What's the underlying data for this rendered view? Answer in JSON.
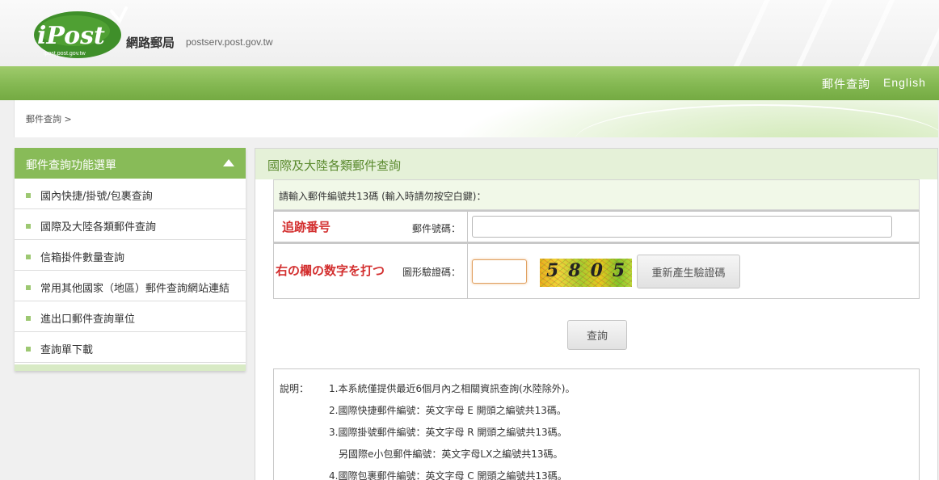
{
  "header": {
    "logo_text": "iPost",
    "logo_sub": "ipost.post.gov.tw",
    "site_name": "網路郵局",
    "site_domain": "postserv.post.gov.tw"
  },
  "nav": {
    "items": [
      {
        "label": "郵件查詢"
      },
      {
        "label": "English"
      }
    ]
  },
  "breadcrumb": "郵件查詢 >",
  "sidebar": {
    "title": "郵件查詢功能選單",
    "items": [
      {
        "label": "國內快捷/掛號/包裹查詢"
      },
      {
        "label": "國際及大陸各類郵件查詢"
      },
      {
        "label": "信箱掛件數量查詢"
      },
      {
        "label": "常用其他國家（地區）郵件查詢網站連結"
      },
      {
        "label": "進出口郵件查詢單位"
      },
      {
        "label": "查詢單下載"
      }
    ]
  },
  "main": {
    "title": "國際及大陸各類郵件查詢",
    "instruction": "請輸入郵件編號共13碼 (輸入時請勿按空白鍵)：",
    "tracking": {
      "annotation": "追跡番号",
      "label": "郵件號碼：",
      "value": ""
    },
    "captcha": {
      "annotation": "右の欄の数字を打つ",
      "label": "圖形驗證碼：",
      "value": "",
      "image_text": "5805",
      "regen_label": "重新產生驗證碼"
    },
    "submit_label": "查詢",
    "notes": {
      "label": "說明：",
      "lines": [
        "1.本系統僅提供最近6個月內之相關資訊查詢(水陸除外)。",
        "2.國際快捷郵件編號：英文字母 E 開頭之編號共13碼。",
        "3.國際掛號郵件編號：英文字母 R 開頭之編號共13碼。",
        "另國際e小包郵件編號：英文字母LX之編號共13碼。",
        "4.國際包裹郵件編號：英文字母 C 開頭之編號共13碼。"
      ]
    }
  },
  "colors": {
    "nav_green": "#84b852",
    "panel_head_bg": "#e5f1d8",
    "annotation_red": "#d32f2f"
  }
}
